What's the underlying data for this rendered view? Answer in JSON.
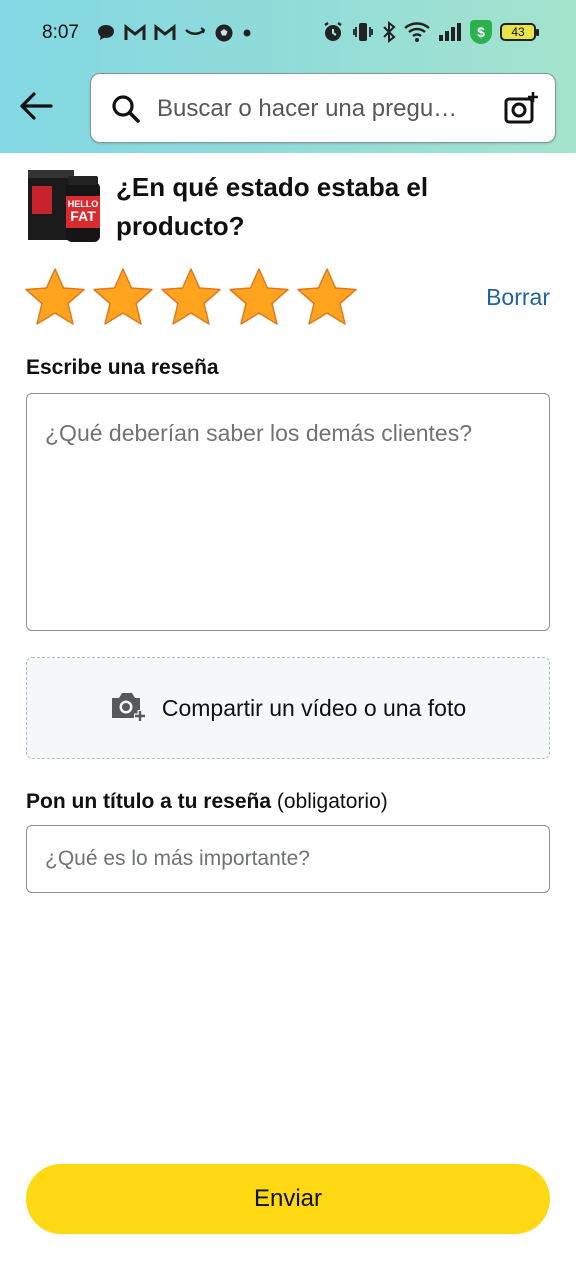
{
  "status_bar": {
    "time": "8:07",
    "battery": "43",
    "shield_symbol": "$",
    "left_icons": [
      "chat-bubble-icon",
      "gmail-icon",
      "gmail-icon",
      "amazon-smile-icon",
      "soccer-ball-icon",
      "dot-icon"
    ],
    "right_icons": [
      "alarm-icon",
      "vibrate-icon",
      "bluetooth-icon",
      "wifi-icon",
      "signal-icon",
      "shield-icon",
      "battery-icon"
    ]
  },
  "header": {
    "search_placeholder": "Buscar o hacer una pregu…",
    "accent_gradient": [
      "#82d8e3",
      "#a5e4cd"
    ]
  },
  "product": {
    "image_label_line1": "HELLO",
    "image_label_line2": "FAT",
    "question": "¿En qué estado estaba el producto?"
  },
  "rating": {
    "value": 5,
    "max": 5,
    "star_color": "#ffa41c",
    "clear_label": "Borrar"
  },
  "review": {
    "label": "Escribe una reseña",
    "placeholder": "¿Qué deberían saber los demás clientes?"
  },
  "media": {
    "label": "Compartir un vídeo o una foto"
  },
  "title_field": {
    "label": "Pon un título a tu reseña",
    "optional_note": "(obligatorio)",
    "placeholder": "¿Qué es lo más importante?"
  },
  "submit": {
    "label": "Enviar",
    "color": "#ffd814"
  }
}
